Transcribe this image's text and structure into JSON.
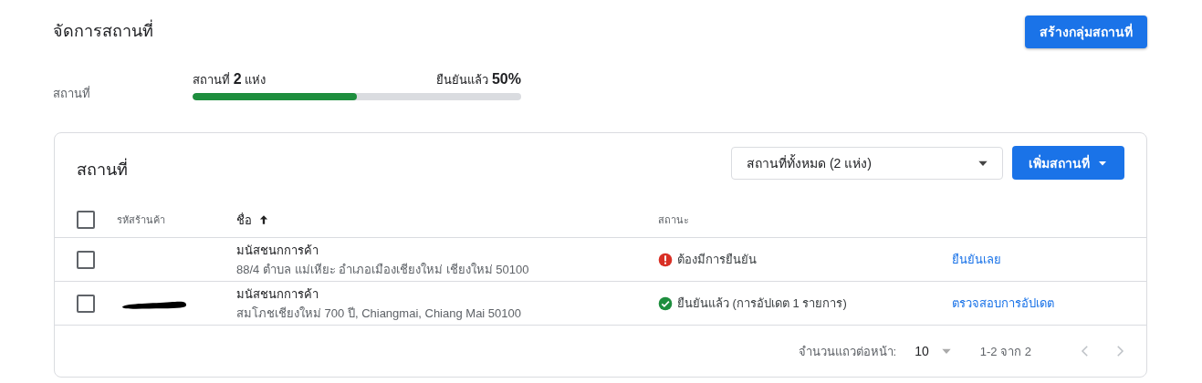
{
  "page": {
    "title": "จัดการสถานที่",
    "create_group_button": "สร้างกลุ่มสถานที่"
  },
  "summary": {
    "label": "สถานที่",
    "count_text": "สถานที่ **2** แห่ง",
    "verified_text": "ยืนยันแล้ว **50%**",
    "level": 0.5
  },
  "locations_card": {
    "title": "สถานที่",
    "filter": "สถานที่ทั้งหมด (2 แห่ง)",
    "add_button": "เพิ่มสถานที่",
    "columns": [
      {
        "label": "รหัสร้านค้า",
        "sorted": false
      },
      {
        "label": "ชื่อ",
        "sorted": true
      },
      {
        "label": "สถานะ",
        "sorted": false
      }
    ],
    "select_all_checked": false,
    "rows": [
      {
        "checked": false,
        "code_redacted": false,
        "name": "มนัสชนกการค้า",
        "address": "88/4 ตำบล แม่เหียะ อำเภอเมืองเชียงใหม่ เชียงใหม่ 50100",
        "kind": "error",
        "status": "ต้องมีการยืนยัน",
        "action": "ยืนยันเลย"
      },
      {
        "checked": false,
        "code_redacted": true,
        "name": "มนัสชนกการค้า",
        "address": "สมโภชเชียงใหม่ 700 ปี, Chiangmai, Chiang Mai 50100",
        "kind": "ok",
        "status": "ยืนยันแล้ว (การอัปเดต 1 รายการ)",
        "action": "ตรวจสอบการอัปเดต"
      }
    ],
    "pagination": {
      "rows_per_page_label": "จำนวนแถวต่อหน้า:",
      "rows_per_page": "10",
      "range": "1-2 จาก 2",
      "prev_disabled": true,
      "next_disabled": true
    }
  }
}
